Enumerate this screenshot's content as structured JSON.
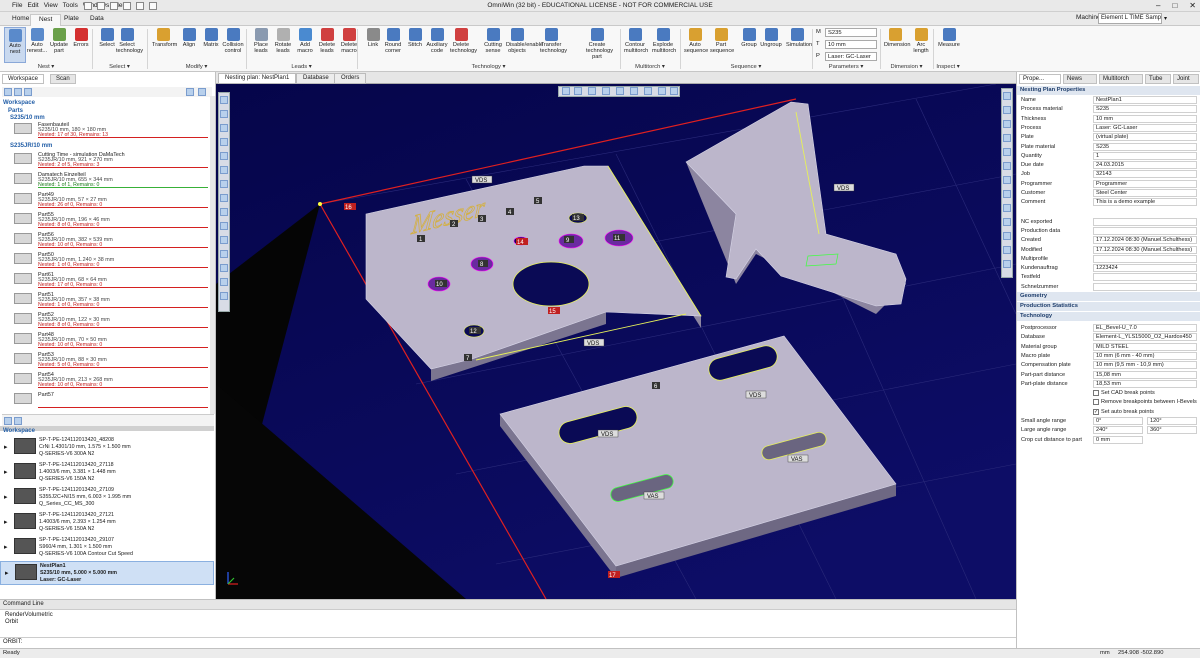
{
  "app": {
    "title": "OmniWin (32 bit) - EDUCATIONAL LICENSE - NOT FOR COMMERCIAL USE",
    "menu": [
      "File",
      "Edit",
      "View",
      "Tools",
      "Windows",
      "Help"
    ]
  },
  "tabs": [
    "Home",
    "Nest",
    "Plate",
    "Data"
  ],
  "machine": {
    "label": "Machine",
    "value": "Element L TIME Sample"
  },
  "ribbon": {
    "buttons": [
      {
        "label": "Auto nest",
        "group": 0
      },
      {
        "label": "Auto renest...",
        "group": 0
      },
      {
        "label": "Update part",
        "group": 0
      },
      {
        "label": "Errors",
        "group": 0
      },
      {
        "label": "Select",
        "group": 1
      },
      {
        "label": "Select technology",
        "group": 1
      },
      {
        "label": "Transform",
        "group": 2
      },
      {
        "label": "Align",
        "group": 2
      },
      {
        "label": "Matrix",
        "group": 2
      },
      {
        "label": "Collision control",
        "group": 2
      },
      {
        "label": "Place leads",
        "group": 3
      },
      {
        "label": "Rotate leads",
        "group": 3
      },
      {
        "label": "Add macro",
        "group": 3
      },
      {
        "label": "Delete leads",
        "group": 3
      },
      {
        "label": "Delete macro",
        "group": 3
      },
      {
        "label": "Link",
        "group": 4
      },
      {
        "label": "Round corner",
        "group": 4
      },
      {
        "label": "Stitch",
        "group": 4
      },
      {
        "label": "Auxiliary code",
        "group": 4
      },
      {
        "label": "Delete technology",
        "group": 4
      },
      {
        "label": "Cutting sense",
        "group": 4
      },
      {
        "label": "Disable/enable objects",
        "group": 4
      },
      {
        "label": "Transfer technology",
        "group": 4
      },
      {
        "label": "Create technology part",
        "group": 4
      },
      {
        "label": "Contour multitorch",
        "group": 5
      },
      {
        "label": "Explode multitorch",
        "group": 5
      },
      {
        "label": "Auto sequence",
        "group": 6
      },
      {
        "label": "Part sequence",
        "group": 6
      },
      {
        "label": "Group",
        "group": 6
      },
      {
        "label": "Ungroup",
        "group": 6
      },
      {
        "label": "Simulation",
        "group": 6
      },
      {
        "label": "Dimension",
        "group": 8
      },
      {
        "label": "Arc length",
        "group": 8
      },
      {
        "label": "Measure",
        "group": 9
      }
    ],
    "groups": [
      "Nest",
      "Select",
      "Modify",
      "Leads",
      "Technology",
      "Multitorch",
      "Sequence",
      "Parameters",
      "Dimension",
      "Inspect"
    ],
    "parameters": [
      {
        "key": "M",
        "value": "S235"
      },
      {
        "key": "T",
        "value": "10 mm"
      },
      {
        "key": "P",
        "value": "Laser: GC-Laser"
      }
    ]
  },
  "left": {
    "tabs": [
      "Workspace",
      "Scan"
    ],
    "workspace_label": "Workspace",
    "parts_label": "Parts",
    "group1": "S235/10 mm",
    "group2": "S235JR/10 mm",
    "parts": [
      {
        "name": "Fasenbauteil",
        "dim": "S235/10 mm, 180 × 180 mm",
        "nested": "Nested: 17 of 30, Remains: 13",
        "status": "red"
      },
      {
        "name": "Cutting Time - simulation DaMaTech",
        "dim": "S235JR/10 mm, 921 × 270 mm",
        "nested": "Nested: 2 of 5, Remains: 3",
        "status": "red"
      },
      {
        "name": "Damatech Einzelteil",
        "dim": "S235JR/10 mm, 655 × 344 mm",
        "nested": "Nested: 1 of 1, Remains: 0",
        "status": "green"
      },
      {
        "name": "Part49",
        "dim": "S235JR/10 mm, 57 × 27 mm",
        "nested": "Nested: 26 of 0, Remains: 0",
        "status": "red"
      },
      {
        "name": "Part55",
        "dim": "S235JR/10 mm, 196 × 46 mm",
        "nested": "Nested: 8 of 0, Remains: 0",
        "status": "red"
      },
      {
        "name": "Part56",
        "dim": "S235JR/10 mm, 382 × 539 mm",
        "nested": "Nested: 10 of 0, Remains: 0",
        "status": "red"
      },
      {
        "name": "Part50",
        "dim": "S235JR/10 mm, 1.240 × 38 mm",
        "nested": "Nested: 1 of 0, Remains: 0",
        "status": "red"
      },
      {
        "name": "Part61",
        "dim": "S235JR/10 mm, 68 × 64 mm",
        "nested": "Nested: 17 of 0, Remains: 0",
        "status": "red"
      },
      {
        "name": "Part51",
        "dim": "S235JR/10 mm, 357 × 38 mm",
        "nested": "Nested: 1 of 0, Remains: 0",
        "status": "red"
      },
      {
        "name": "Part52",
        "dim": "S235JR/10 mm, 122 × 30 mm",
        "nested": "Nested: 8 of 0, Remains: 0",
        "status": "red"
      },
      {
        "name": "Part48",
        "dim": "S235JR/10 mm, 70 × 50 mm",
        "nested": "Nested: 10 of 0, Remains: 0",
        "status": "red"
      },
      {
        "name": "Part53",
        "dim": "S235JR/10 mm, 88 × 30 mm",
        "nested": "Nested: 5 of 0, Remains: 0",
        "status": "red"
      },
      {
        "name": "Part54",
        "dim": "S235JR/10 mm, 213 × 268 mm",
        "nested": "Nested: 10 of 0, Remains: 0",
        "status": "red"
      },
      {
        "name": "Part57",
        "dim": "",
        "nested": "",
        "status": "red"
      }
    ],
    "workspace_items": [
      {
        "l1": "SP-T-PE-124112013420_48208",
        "l2": "CrNi 1.4301/10 mm, 1.575 × 1.500 mm",
        "l3": "Q-SERIES-V6 300A N2"
      },
      {
        "l1": "SP-T-PE-124112013420_27118",
        "l2": "1.4003/6 mm, 3.381 × 1.448 mm",
        "l3": "Q-SERIES-V6 150A N2"
      },
      {
        "l1": "SP-T-PE-124112013420_27109",
        "l2": "S355J2C+N/15 mm, 6.003 × 1.995 mm",
        "l3": "Q_Series_CC_MS_300"
      },
      {
        "l1": "SP-T-PE-124112013420_27121",
        "l2": "1.4003/6 mm, 2.393 × 1.254 mm",
        "l3": "Q-SERIES-V6 150A N2"
      },
      {
        "l1": "SP-T-PE-124112013420_29107",
        "l2": "S960/4 mm, 1.301 × 1.500 mm",
        "l3": "Q-SERIES-V6 100A Contour Cut Speed"
      },
      {
        "l1": "NestPlan1",
        "l2": "S235/10 mm, 5.000 × 5.000 mm",
        "l3": "Laser: GC-Laser"
      }
    ]
  },
  "middle": {
    "tabs": [
      "Nesting plan: NestPlan1",
      "Database",
      "Orders"
    ]
  },
  "viewport": {
    "engraving": "Messer",
    "labels": [
      "1",
      "2",
      "3",
      "4",
      "5",
      "6",
      "7",
      "8",
      "9",
      "10",
      "11",
      "12",
      "13",
      "14",
      "15",
      "16",
      "17"
    ],
    "marks": [
      "VDS",
      "VAS"
    ]
  },
  "right": {
    "tabs": [
      "Prope...",
      "News",
      "Multitorch",
      "Tube",
      "Joint"
    ],
    "header": "Nesting Plan Properties",
    "props": [
      {
        "k": "Name",
        "v": "NestPlan1"
      },
      {
        "k": "Process material",
        "v": "S235"
      },
      {
        "k": "Thickness",
        "v": "10 mm"
      },
      {
        "k": "Process",
        "v": "Laser: GC-Laser"
      },
      {
        "k": "Plate",
        "v": "(virtual plate)"
      },
      {
        "k": "Plate material",
        "v": "S235"
      },
      {
        "k": "Quantity",
        "v": "1"
      },
      {
        "k": "Due date",
        "v": "24.03.2015"
      },
      {
        "k": "Job",
        "v": "32143"
      },
      {
        "k": "Programmer",
        "v": "Programmer"
      },
      {
        "k": "Customer",
        "v": "Steel Center"
      },
      {
        "k": "Comment",
        "v": "This is a demo example"
      }
    ],
    "props2": [
      {
        "k": "NC exported",
        "v": ""
      },
      {
        "k": "Production data",
        "v": ""
      },
      {
        "k": "Created",
        "v": "17.12.2024 08:30 (Manuel.Schulthess)"
      },
      {
        "k": "Modified",
        "v": "17.12.2024 08:30 (Manuel.Schulthess)"
      },
      {
        "k": "Multiprofile",
        "v": ""
      },
      {
        "k": "Kundenauftrag",
        "v": "1223424"
      },
      {
        "k": "Testfeld",
        "v": ""
      },
      {
        "k": "Schnelzummer",
        "v": ""
      }
    ],
    "sections": [
      "Geometry",
      "Production Statistics",
      "Technology"
    ],
    "tech": [
      {
        "k": "Postprocessor",
        "v": "EL_Bevel-U_7.0"
      },
      {
        "k": "Database",
        "v": "Element-L_YLS15000_O2_Hardox450"
      },
      {
        "k": "Material group",
        "v": "MILD STEEL"
      },
      {
        "k": "Macro plate",
        "v": "10 mm (6 mm - 40 mm)"
      },
      {
        "k": "Compensation plate",
        "v": "10 mm (9,5 mm - 10,9 mm)"
      },
      {
        "k": "Part-part distance",
        "v": "15,08 mm"
      },
      {
        "k": "Part-plate distance",
        "v": "18,53 mm"
      }
    ],
    "checks": [
      {
        "label": "Set CAD break points",
        "checked": false
      },
      {
        "label": "Remove breakpoints between I-Bevels",
        "checked": false
      },
      {
        "label": "Set auto break points",
        "checked": true
      }
    ],
    "angles": [
      {
        "k": "Small angle range",
        "a": "0°",
        "b": "120°"
      },
      {
        "k": "Large angle range",
        "a": "240°",
        "b": "360°"
      },
      {
        "k": "Crop cut distance to part",
        "a": "0 mm",
        "b": ""
      }
    ]
  },
  "cmd": {
    "title": "Command Line",
    "lines": [
      "RenderVolumetric",
      "Orbit"
    ],
    "prompt": "ORBIT:"
  },
  "status": {
    "left": "Ready",
    "unit": "mm",
    "coords": "254.908   -502.890"
  },
  "colors": {
    "accent": "#2560a8",
    "viewport_bg": "#0a0a5a",
    "part_fill": "#b9b2c8",
    "red": "#d42020",
    "green": "#38b038"
  }
}
